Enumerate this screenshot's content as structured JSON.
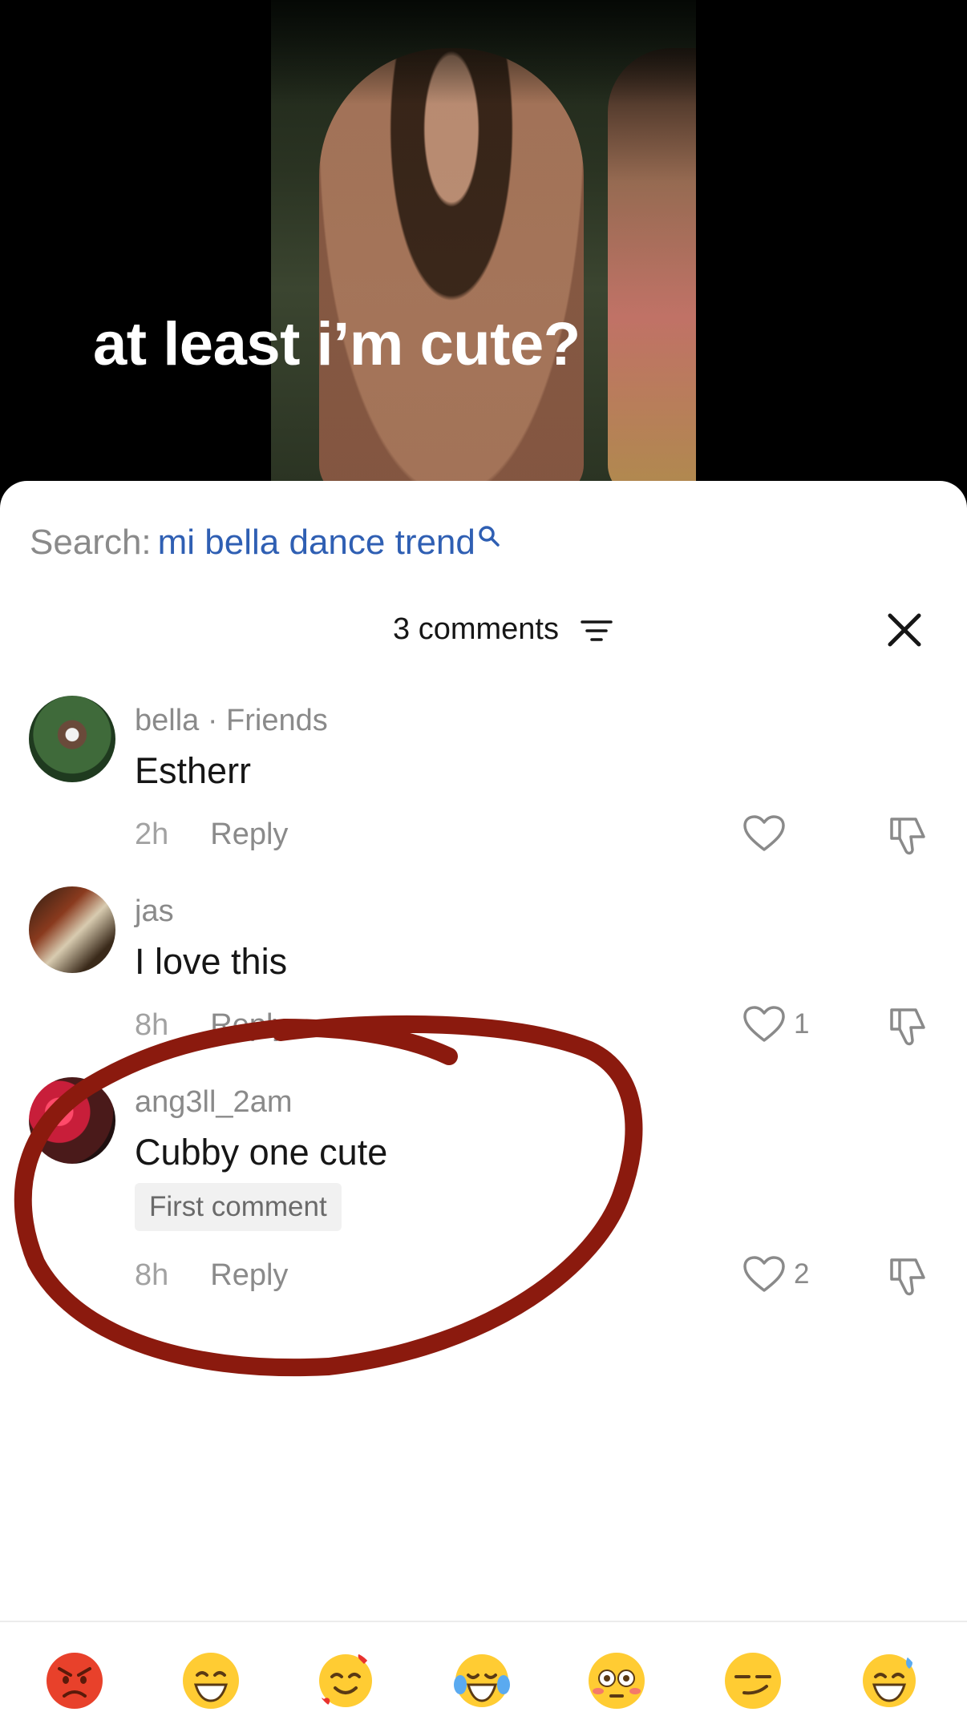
{
  "video": {
    "caption": "at least i’m cute?"
  },
  "search": {
    "label": "Search:",
    "term": "mi bella dance trend"
  },
  "header": {
    "count_label": "3 comments"
  },
  "comments": [
    {
      "username": "bella · Friends",
      "text": "Estherr",
      "time": "2h",
      "reply": "Reply",
      "likes": ""
    },
    {
      "username": "jas",
      "text": "I love this",
      "time": "8h",
      "reply": "Reply",
      "likes": "1"
    },
    {
      "username": "ang3ll_2am",
      "text": "Cubby one cute",
      "badge": "First comment",
      "time": "8h",
      "reply": "Reply",
      "likes": "2"
    }
  ],
  "emoji_bar": [
    "angry-face",
    "grinning-face",
    "smiling-face-with-hearts",
    "tears-of-joy-face",
    "flushed-face",
    "smirking-face",
    "grinning-sweat-face"
  ],
  "colors": {
    "search_term": "#2f5fb3",
    "annotation": "#8b1a0e",
    "muted_text": "#8a8a8a"
  }
}
